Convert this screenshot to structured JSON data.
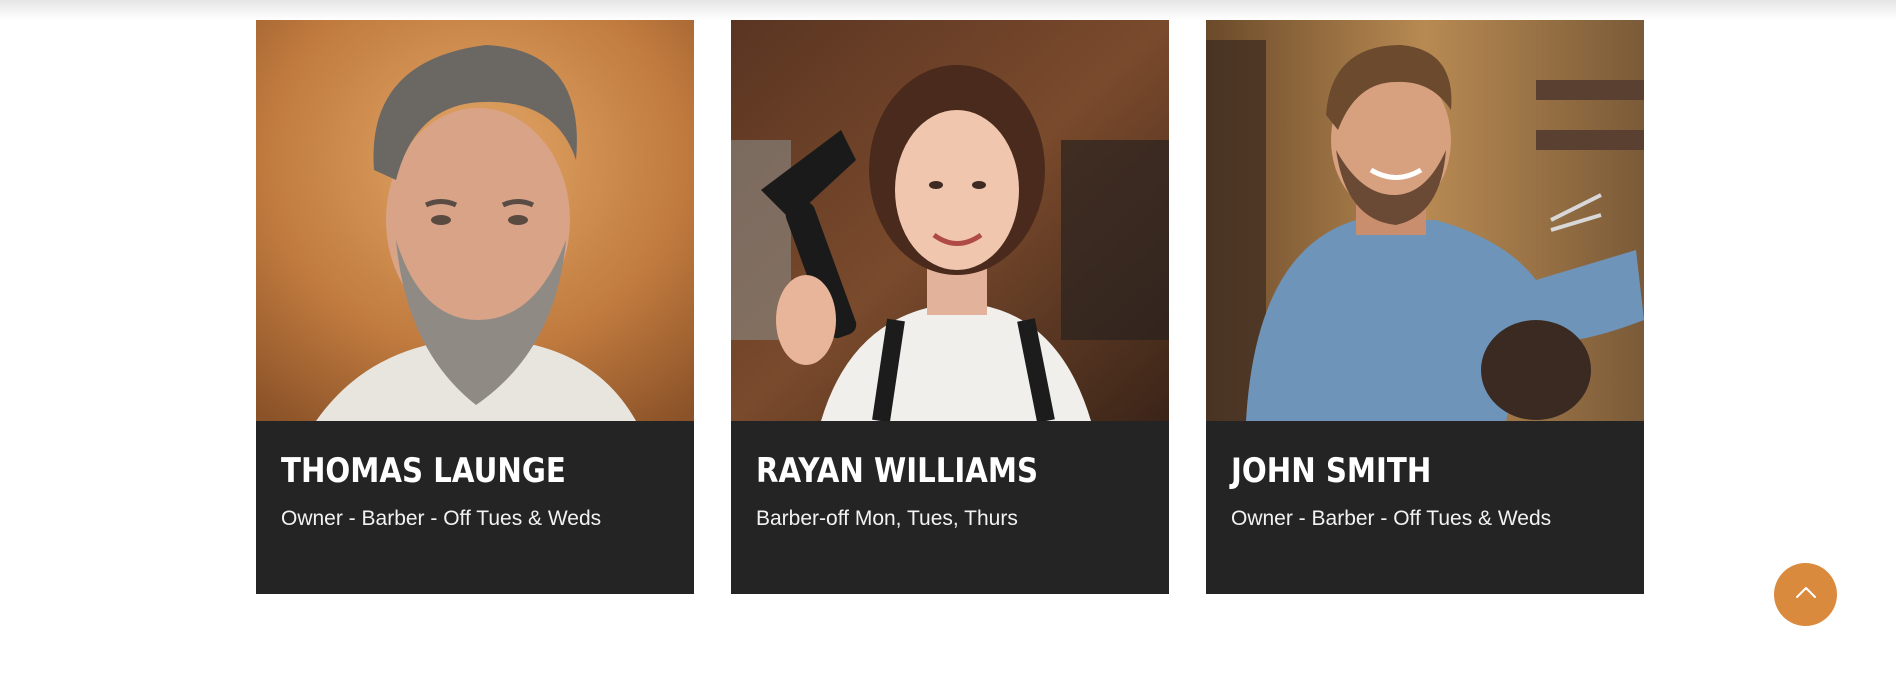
{
  "team": {
    "members": [
      {
        "name": "THOMAS LAUNGE",
        "role": "Owner - Barber - Off Tues & Weds",
        "photo": "portrait-bearded-man"
      },
      {
        "name": "RAYAN WILLIAMS",
        "role": "Barber-off Mon, Tues, Thurs",
        "photo": "portrait-woman-with-hair-dryer"
      },
      {
        "name": "JOHN SMITH",
        "role": "Owner - Barber - Off Tues & Weds",
        "photo": "portrait-barber-cutting-hair"
      }
    ]
  },
  "scroll_top": {
    "icon": "chevron-up-icon"
  },
  "colors": {
    "card_background": "#242424",
    "accent": "#d98a3d",
    "text": "#ffffff"
  }
}
